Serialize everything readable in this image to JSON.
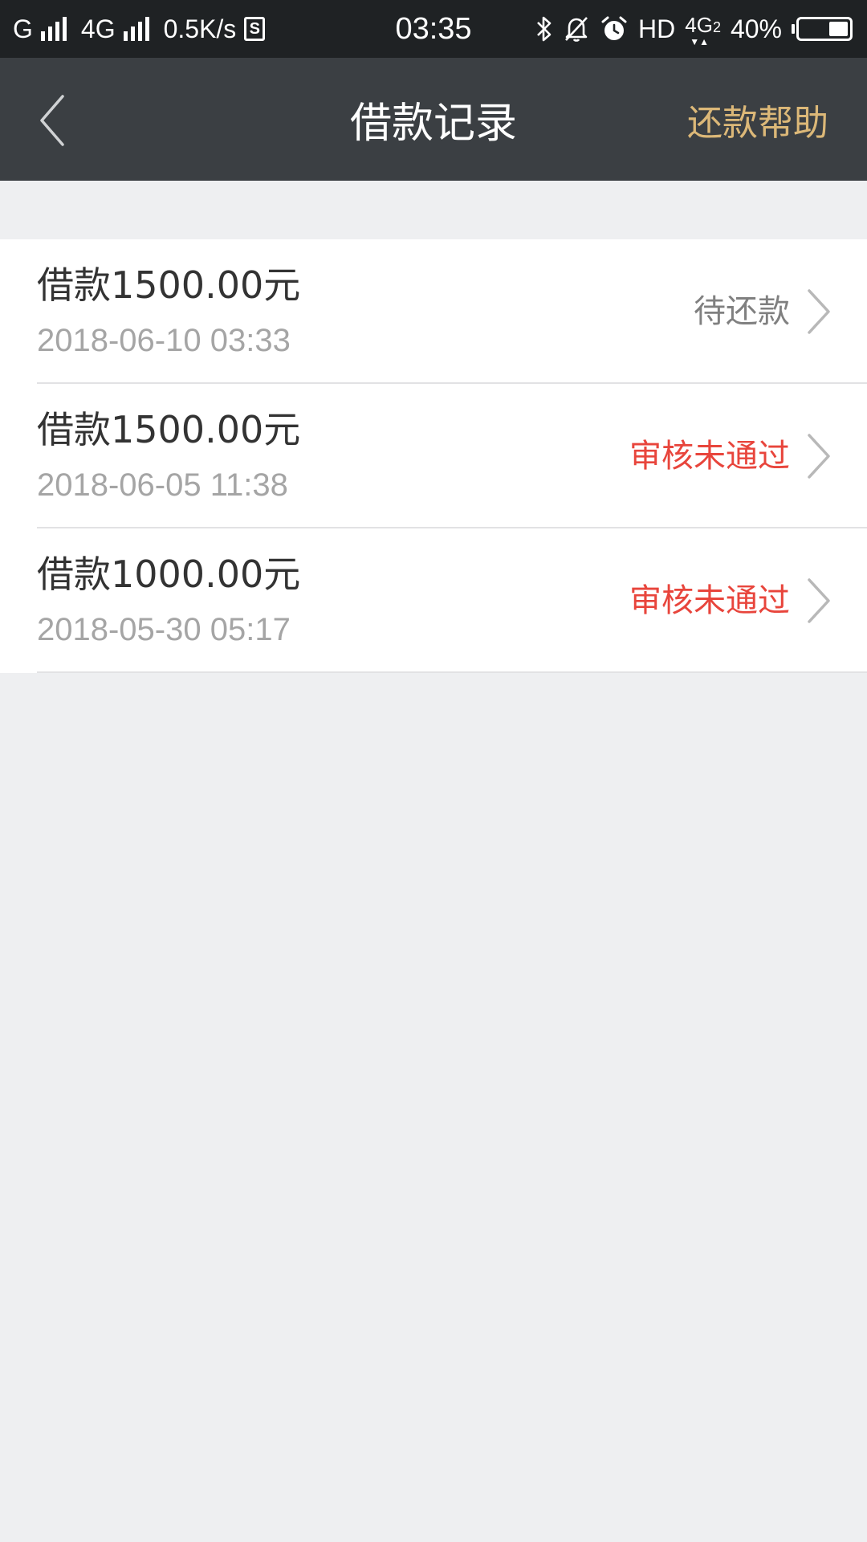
{
  "status_bar": {
    "network1": "G",
    "network2": "4G",
    "speed": "0.5K/s",
    "sim_icon_text": "S",
    "time": "03:35",
    "hd": "HD",
    "lte": "4G",
    "lte_sub": "2",
    "battery": "40%",
    "battery_level": 0.4,
    "icons": [
      "signal-icon",
      "sim-icon",
      "bluetooth-icon",
      "bell-muted-icon",
      "alarm-icon",
      "battery-icon"
    ]
  },
  "nav": {
    "back_icon": "chevron-left-icon",
    "title": "借款记录",
    "help_label": "还款帮助"
  },
  "records": [
    {
      "amount": "借款1500.00元",
      "date": "2018-06-10 03:33",
      "status": "待还款",
      "status_color": "#808080"
    },
    {
      "amount": "借款1500.00元",
      "date": "2018-06-05 11:38",
      "status": "审核未通过",
      "status_color": "#e8453c"
    },
    {
      "amount": "借款1000.00元",
      "date": "2018-05-30 05:17",
      "status": "审核未通过",
      "status_color": "#e8453c"
    }
  ],
  "colors": {
    "status_bar_bg": "#1f2224",
    "nav_bg": "#3b3f43",
    "help_accent": "#dcb878",
    "page_bg": "#eeeff1"
  }
}
